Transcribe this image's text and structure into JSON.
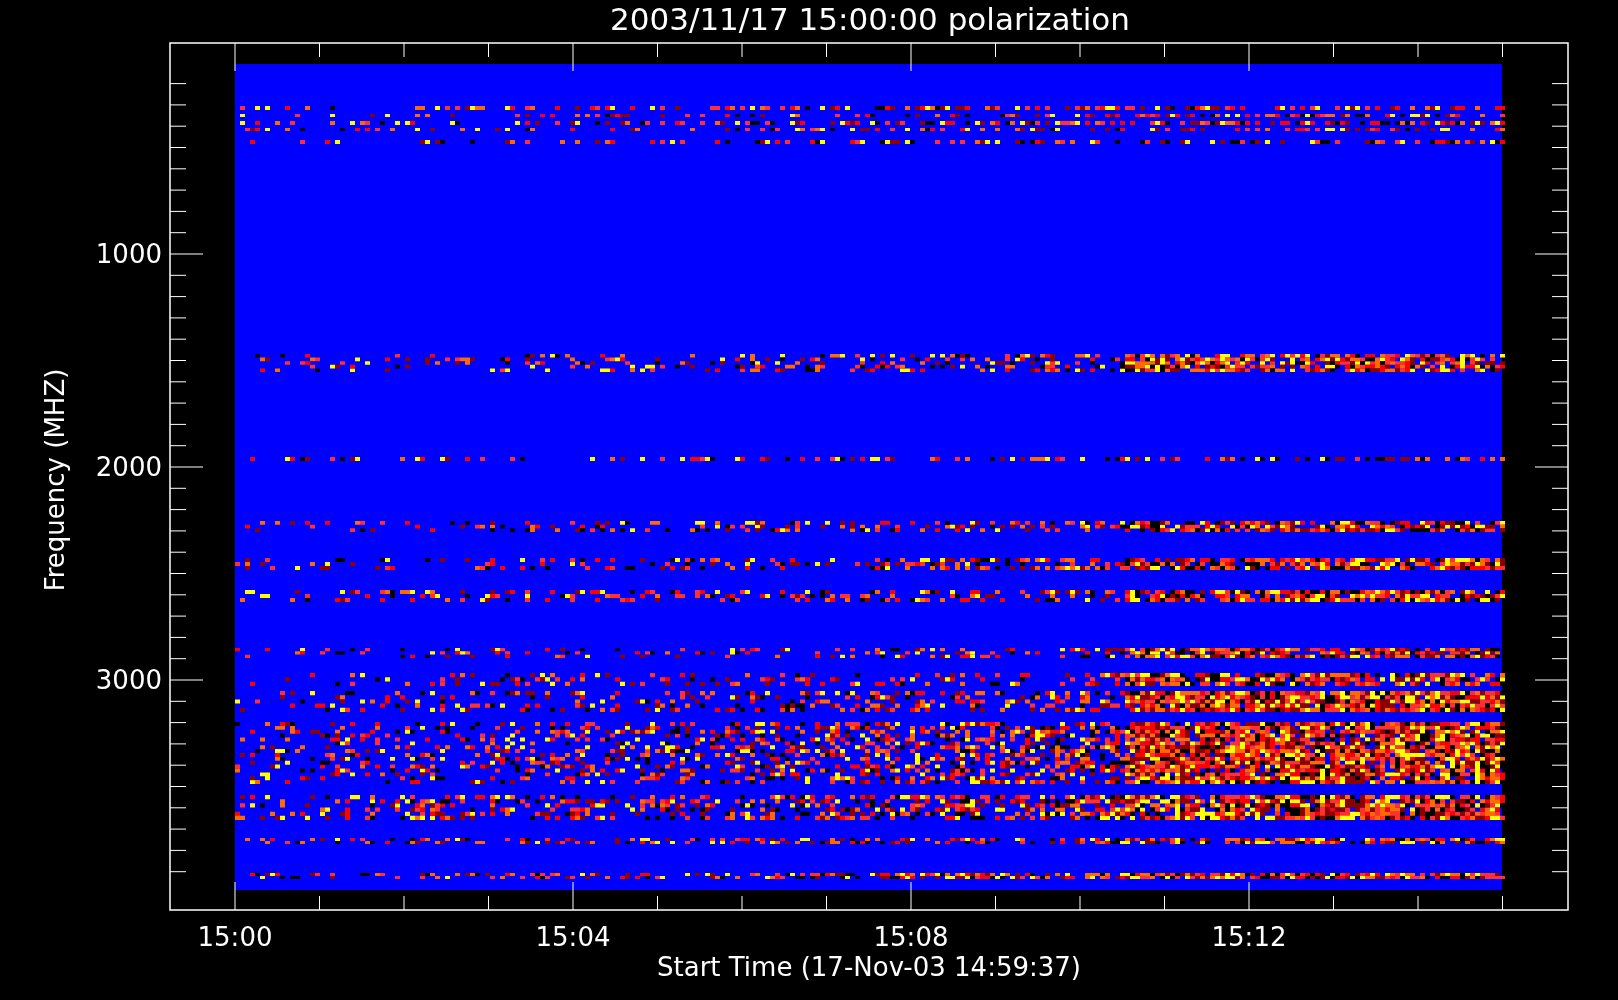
{
  "title": "2003/11/17 15:00:00 polarization",
  "y_axis": {
    "label": "Frequency (MHZ)",
    "ticks": [
      "1000",
      "2000",
      "3000"
    ]
  },
  "x_axis": {
    "label": "Start Time (17-Nov-03 14:59:37)",
    "ticks": [
      "15:00",
      "15:04",
      "15:08",
      "15:12"
    ]
  }
}
